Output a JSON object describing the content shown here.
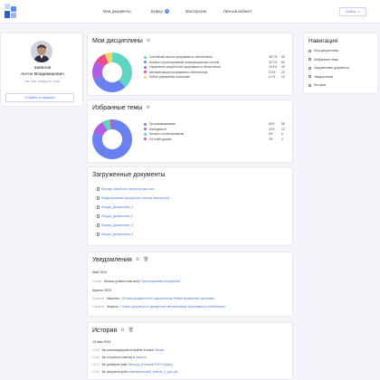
{
  "nav": {
    "items": [
      "Мои документы",
      "Буфер",
      "Мастерская",
      "Личный кабинет"
    ],
    "badge": "2",
    "login": "Войти"
  },
  "profile": {
    "name_line1": "Завялов",
    "name_line2": "Антон Владимирович",
    "subtitle": "Зав. каф. кафедрой, проф.",
    "button": "Выйти из аккаунта"
  },
  "sidenav": {
    "title": "Навигация",
    "items": [
      "Мои дисциплины",
      "Избранные темы",
      "Загруженные документы",
      "Уведомления",
      "История"
    ]
  },
  "disciplines": {
    "title": "Мои дисциплины",
    "rows": [
      {
        "label": "Системный анализ программного обеспечения",
        "pct": "38.7%",
        "cnt": "98",
        "color": "#5cd6c0"
      },
      {
        "label": "Анализ и проектирование информационных систем",
        "pct": "30.7%",
        "cnt": "69",
        "color": "#6a7ff0"
      },
      {
        "label": "Управление разработкой программного обеспечения",
        "pct": "15.3%",
        "cnt": "49",
        "color": "#b15ce0"
      },
      {
        "label": "Автоматизация программного обеспечения",
        "pct": "9.2%",
        "cnt": "20",
        "color": "#ea4c8a"
      },
      {
        "label": "Гибкое управление проектами",
        "pct": "6.1%",
        "cnt": "15",
        "color": "#f4d35e"
      }
    ],
    "chart_data": {
      "type": "pie",
      "categories": [
        "Системный анализ программного обеспечения",
        "Анализ и проектирование информационных систем",
        "Управление разработкой программного обеспечения",
        "Автоматизация программного обеспечения",
        "Гибкое управление проектами"
      ],
      "values": [
        38.7,
        30.7,
        15.3,
        9.2,
        6.1
      ],
      "center_label_top": "",
      "center_label_bottom": ""
    }
  },
  "topics": {
    "title": "Избранные темы",
    "rows": [
      {
        "label": "Программирование",
        "pct": "80%",
        "cnt": "88",
        "color": "#6a7ff0"
      },
      {
        "label": "Менеджмент",
        "pct": "12%",
        "cnt": "13",
        "color": "#b15ce0"
      },
      {
        "label": "Анализ и проектирование",
        "pct": "6%",
        "cnt": "6",
        "color": "#5cd6c0"
      },
      {
        "label": "UX и веб-дизайн",
        "pct": "2%",
        "cnt": "2",
        "color": "#ea4c8a"
      }
    ],
    "chart_data": {
      "type": "pie",
      "categories": [
        "Программирование",
        "Менеджмент",
        "Анализ и проектирование",
        "UX и веб-дизайн"
      ],
      "values": [
        80,
        12,
        6,
        2
      ]
    }
  },
  "documents": {
    "title": "Загруженные документы",
    "items": [
      "Методы обработки сигналов курс.docx",
      "Моделирование процессов и систем бизнеса.pdf",
      "Лекция_Дисциплина_1",
      "Лекция_Дисциплина_2",
      "Лекция_Дисциплина_3",
      "Лекция_Дисциплина_4"
    ]
  },
  "notifications": {
    "title": "Уведомления",
    "groups": [
      {
        "date": "Май 2024",
        "rows": [
          {
            "time": "14 мая",
            "text": "Михаил добавил вам книгу",
            "link": "Проектирование интерфейса"
          }
        ]
      },
      {
        "date": "Апрель 2024",
        "rows": [
          {
            "time": "9 апреля",
            "text": "Кашкенко,",
            "link": "15 новых документов по дисциплинам",
            "link2": "Гибкое управление проектами"
          },
          {
            "time": "1 апреля",
            "text": "Нацепка,",
            "link": "2 новых документа по дисциплине",
            "link2": "Автоматизация программного обеспечения"
          }
        ]
      }
    ]
  },
  "history": {
    "title": "История",
    "date": "13 мая 2024",
    "rows": [
      {
        "time": "13:28",
        "text": "Вы классифицировали файлы в папке",
        "link": "Лекции"
      },
      {
        "time": "10:46",
        "text": "Вы сохранили заметку в",
        "link": "Заметки"
      },
      {
        "time": "10:43",
        "text": "Вы добавили файл",
        "link": "Фактура_Итоговый.PDF в Буфер"
      },
      {
        "time": "10:36",
        "text": "Вы загрузили файл",
        "link": "Математический_анализ_2_курс.pdf"
      }
    ]
  }
}
